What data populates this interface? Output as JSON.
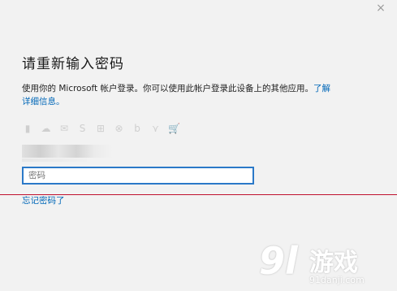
{
  "dialog": {
    "title": "请重新输入密码",
    "desc_text": "使用你的 Microsoft 帐户登录。你可以使用此帐户登录此设备上的其他应用。",
    "learn_more_link_1": "了解",
    "learn_more_link_2": "详细信息。",
    "password_placeholder": "密码",
    "forgot_password": "忘记密码了",
    "close_glyph": "×"
  },
  "service_icons": [
    {
      "name": "office-icon",
      "glyph": "▮"
    },
    {
      "name": "onedrive-icon",
      "glyph": "☁"
    },
    {
      "name": "outlook-icon",
      "glyph": "✉"
    },
    {
      "name": "skype-icon",
      "glyph": "S"
    },
    {
      "name": "windows-icon",
      "glyph": "⊞"
    },
    {
      "name": "xbox-icon",
      "glyph": "⊗"
    },
    {
      "name": "bing-icon",
      "glyph": "b"
    },
    {
      "name": "msn-icon",
      "glyph": "⋎"
    },
    {
      "name": "store-icon",
      "glyph": "🛒"
    }
  ],
  "watermark": {
    "logo": "9l",
    "brand": "游戏",
    "url": "91danji.com"
  },
  "colors": {
    "link": "#0067b8",
    "input_border": "#2b79c8",
    "divider": "#c0112f"
  }
}
